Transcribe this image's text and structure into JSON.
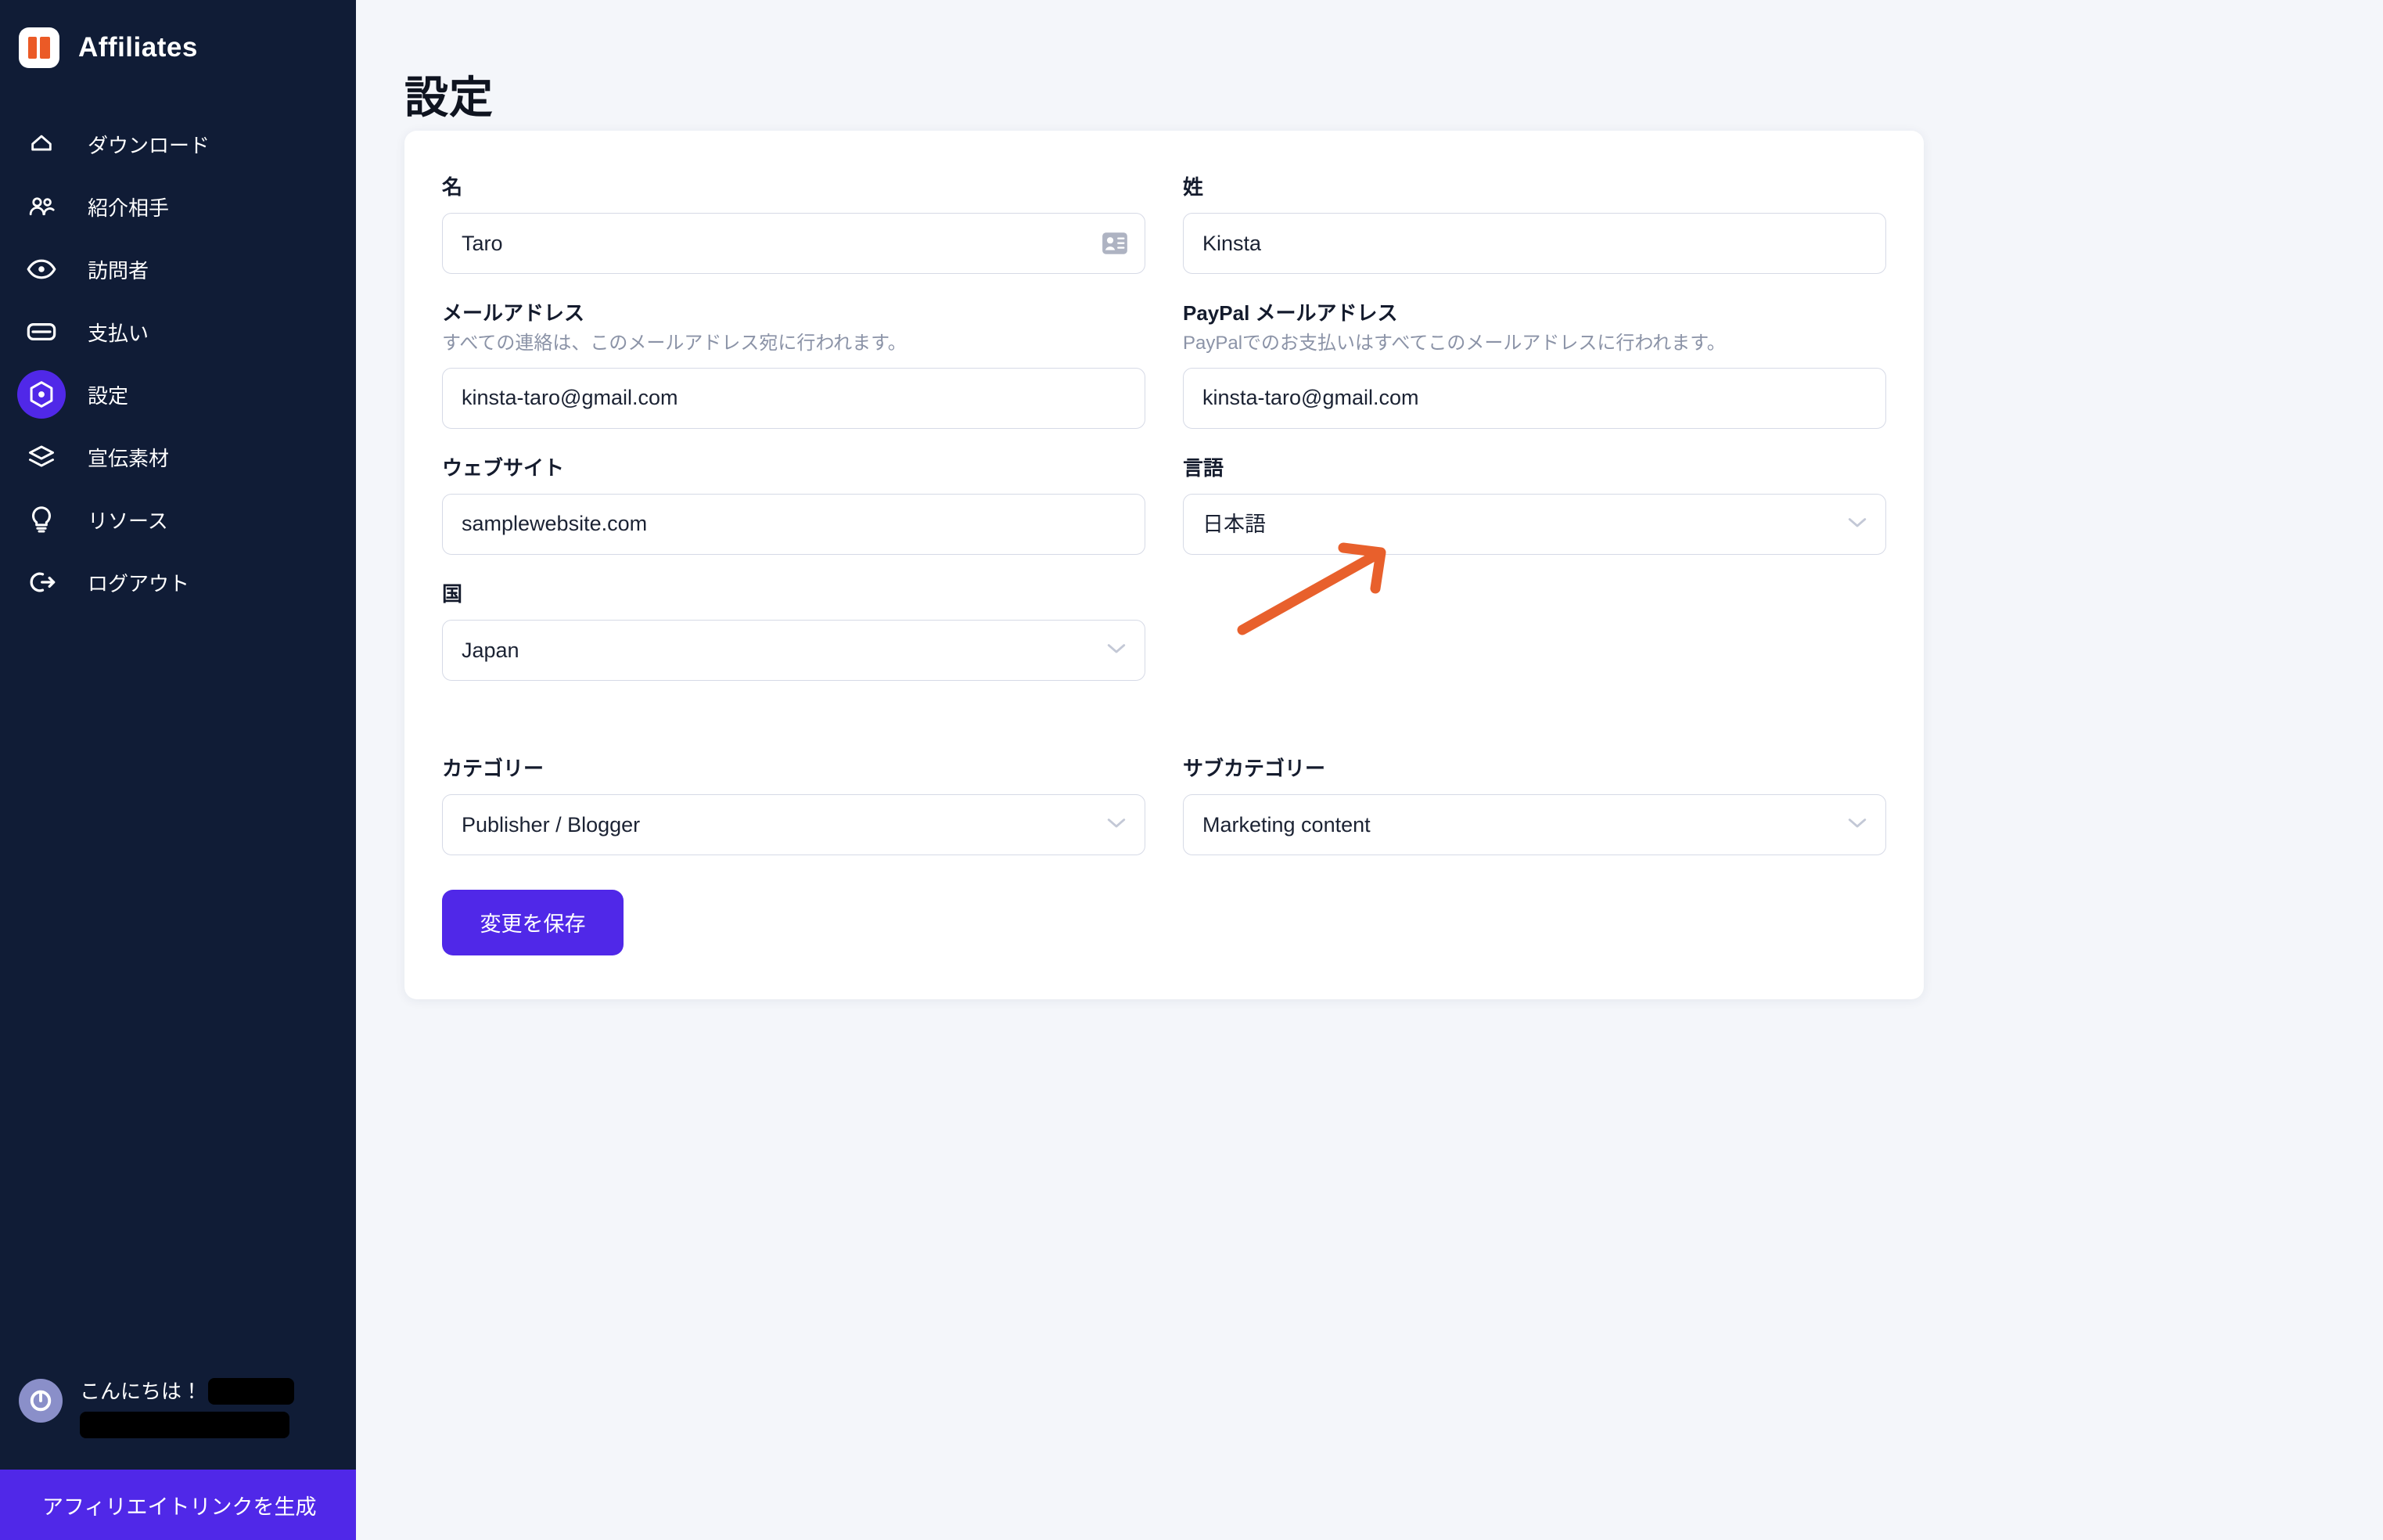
{
  "brand": {
    "title": "Affiliates",
    "logo_icon": "affiliates-logo-icon",
    "logo_color": "#eb5a26"
  },
  "sidebar": {
    "background_color": "#101c36",
    "active_color": "#5028e8",
    "items": [
      {
        "label": "ダウンロード",
        "icon": "home-icon",
        "active": false
      },
      {
        "label": "紹介相手",
        "icon": "users-icon",
        "active": false
      },
      {
        "label": "訪問者",
        "icon": "eye-icon",
        "active": false
      },
      {
        "label": "支払い",
        "icon": "credit-card-icon",
        "active": false
      },
      {
        "label": "設定",
        "icon": "gear-hexagon-icon",
        "active": true
      },
      {
        "label": "宣伝素材",
        "icon": "layers-icon",
        "active": false
      },
      {
        "label": "リソース",
        "icon": "lightbulb-icon",
        "active": false
      },
      {
        "label": "ログアウト",
        "icon": "logout-icon",
        "active": false
      }
    ],
    "footer": {
      "greeting": "こんにちは！",
      "avatar_icon": "avatar-icon",
      "name_redacted": true,
      "generate_link_label": "アフィリエイトリンクを生成"
    }
  },
  "page": {
    "title": "設定"
  },
  "form": {
    "first_name": {
      "label": "名",
      "value": "Taro",
      "placeholder": "",
      "autofill_icon": "contact-card-icon"
    },
    "last_name": {
      "label": "姓",
      "value": "Kinsta",
      "placeholder": ""
    },
    "email": {
      "label": "メールアドレス",
      "hint": "すべての連絡は、このメールアドレス宛に行われます。",
      "value": "kinsta-taro@gmail.com",
      "placeholder": ""
    },
    "paypal_email": {
      "label": "PayPal メールアドレス",
      "hint": "PayPalでのお支払いはすべてこのメールアドレスに行われます。",
      "value": "kinsta-taro@gmail.com",
      "placeholder": ""
    },
    "website": {
      "label": "ウェブサイト",
      "value": "samplewebsite.com",
      "placeholder": ""
    },
    "language": {
      "label": "言語",
      "value": "日本語",
      "options": [
        "日本語"
      ]
    },
    "country": {
      "label": "国",
      "value": "Japan",
      "options": [
        "Japan"
      ]
    },
    "category": {
      "label": "カテゴリー",
      "value": "Publisher / Blogger",
      "options": [
        "Publisher / Blogger"
      ]
    },
    "subcategory": {
      "label": "サブカテゴリー",
      "value": "Marketing content",
      "options": [
        "Marketing content"
      ]
    },
    "save_button": {
      "label": "変更を保存"
    }
  },
  "annotation": {
    "type": "arrow",
    "color": "#e8602c",
    "points_to": "言語"
  }
}
